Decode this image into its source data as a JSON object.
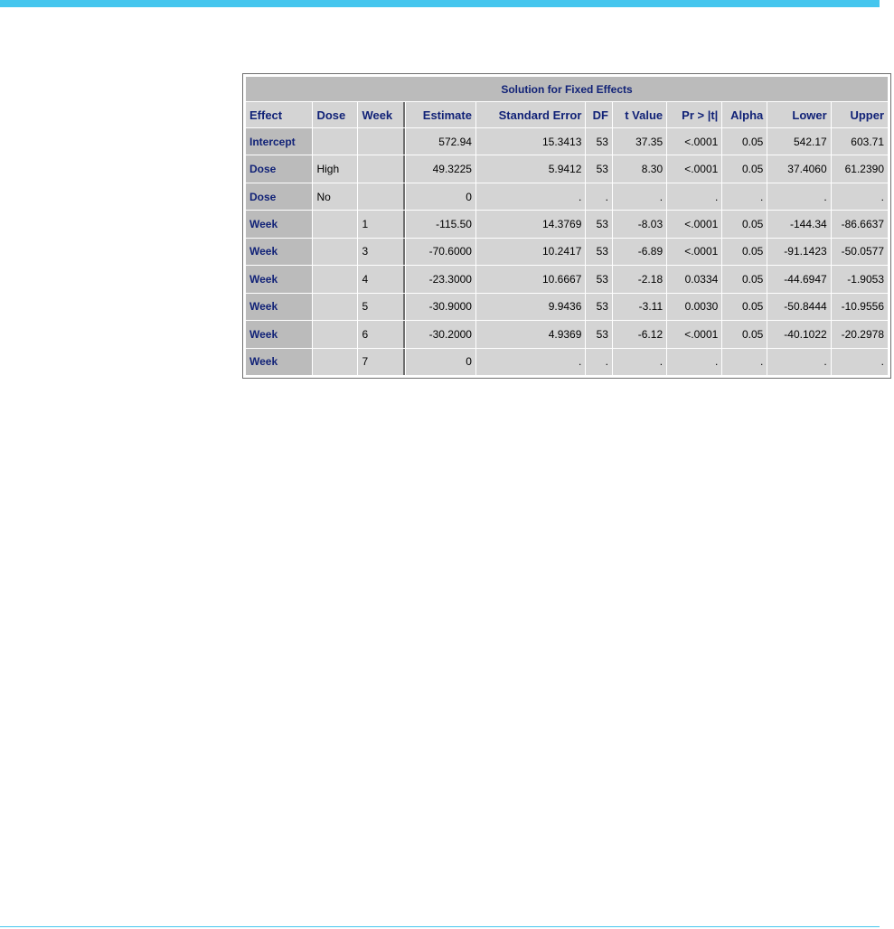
{
  "table": {
    "title": "Solution for Fixed Effects",
    "columns": [
      "Effect",
      "Dose",
      "Week",
      "Estimate",
      "Standard Error",
      "DF",
      "t Value",
      "Pr > |t|",
      "Alpha",
      "Lower",
      "Upper"
    ],
    "rows": [
      [
        "Intercept",
        "",
        "",
        "572.94",
        "15.3413",
        "53",
        "37.35",
        "<.0001",
        "0.05",
        "542.17",
        "603.71"
      ],
      [
        "Dose",
        "High",
        "",
        "49.3225",
        "5.9412",
        "53",
        "8.30",
        "<.0001",
        "0.05",
        "37.4060",
        "61.2390"
      ],
      [
        "Dose",
        "No",
        "",
        "0",
        ".",
        ".",
        ".",
        ".",
        ".",
        ".",
        "."
      ],
      [
        "Week",
        "",
        "1",
        "-115.50",
        "14.3769",
        "53",
        "-8.03",
        "<.0001",
        "0.05",
        "-144.34",
        "-86.6637"
      ],
      [
        "Week",
        "",
        "3",
        "-70.6000",
        "10.2417",
        "53",
        "-6.89",
        "<.0001",
        "0.05",
        "-91.1423",
        "-50.0577"
      ],
      [
        "Week",
        "",
        "4",
        "-23.3000",
        "10.6667",
        "53",
        "-2.18",
        "0.0334",
        "0.05",
        "-44.6947",
        "-1.9053"
      ],
      [
        "Week",
        "",
        "5",
        "-30.9000",
        "9.9436",
        "53",
        "-3.11",
        "0.0030",
        "0.05",
        "-50.8444",
        "-10.9556"
      ],
      [
        "Week",
        "",
        "6",
        "-30.2000",
        "4.9369",
        "53",
        "-6.12",
        "<.0001",
        "0.05",
        "-40.1022",
        "-20.2978"
      ],
      [
        "Week",
        "",
        "7",
        "0",
        ".",
        ".",
        ".",
        ".",
        ".",
        ".",
        "."
      ]
    ]
  },
  "colors": {
    "accent_bar": "#45c6ee",
    "header_text": "#112277",
    "title_bg": "#bbbbbb",
    "cell_bg": "#d4d4d4"
  }
}
